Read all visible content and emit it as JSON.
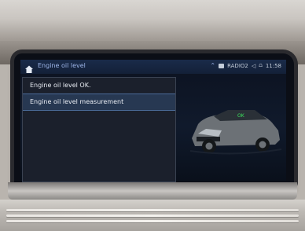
{
  "screen": {
    "title": "Engine oil level",
    "status": {
      "source": "RADIO2",
      "time": "11:58"
    }
  },
  "popup": {
    "items": [
      {
        "label": "Engine oil level OK."
      },
      {
        "label": "Engine oil level measurement",
        "selected": true
      }
    ]
  },
  "vehicle": {
    "oil_indicator": "OK"
  },
  "colors": {
    "accent": "#9db5e8",
    "indicator_ok": "#3be35e",
    "screen_bg": "#0c1220"
  }
}
